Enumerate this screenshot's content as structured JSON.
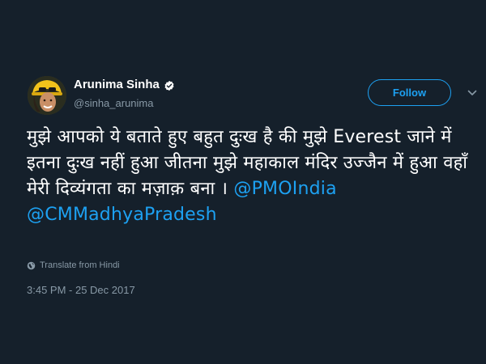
{
  "tweet": {
    "author": {
      "display_name": "Arunima Sinha",
      "handle": "@sinha_arunima",
      "verified": true,
      "avatar_icon": "avatar-photo"
    },
    "follow_label": "Follow",
    "text_main": "मुझे आपको ये बताते हुए बहुत दुःख है की मुझे Everest जाने में इतना दुःख नहीं हुआ जीतना मुझे महाकाल मंदिर उज्जैन में हुआ वहाँ मेरी दिव्यंगता का मज़ाक़ बना । ",
    "mention_1": "@PMOIndia",
    "mention_2": "@CMMadhyaPradesh",
    "translate_label": "Translate from Hindi",
    "timestamp": "3:45 PM - 25 Dec 2017"
  },
  "colors": {
    "background": "#15202b",
    "accent": "#1da1f2",
    "secondary_text": "#8899a6",
    "primary_text": "#ffffff"
  },
  "icons": {
    "verified": "verified-badge-icon",
    "more": "chevron-down-icon",
    "translate": "globe-icon"
  }
}
